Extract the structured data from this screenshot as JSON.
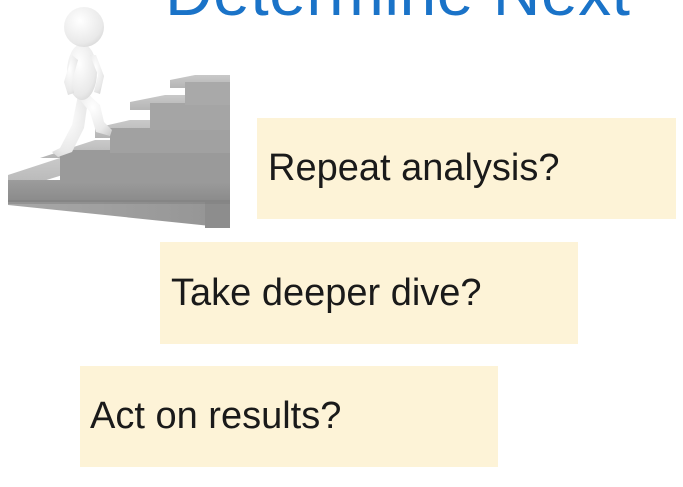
{
  "slide": {
    "title": "Determine Next",
    "illustration": "figure-climbing-stairs-icon",
    "options": [
      {
        "label": "Repeat analysis?"
      },
      {
        "label": "Take deeper dive?"
      },
      {
        "label": "Act on results?"
      }
    ],
    "colors": {
      "title": "#1a73c8",
      "box_fill": "#fdf3d7",
      "text": "#1a1a1a"
    }
  }
}
